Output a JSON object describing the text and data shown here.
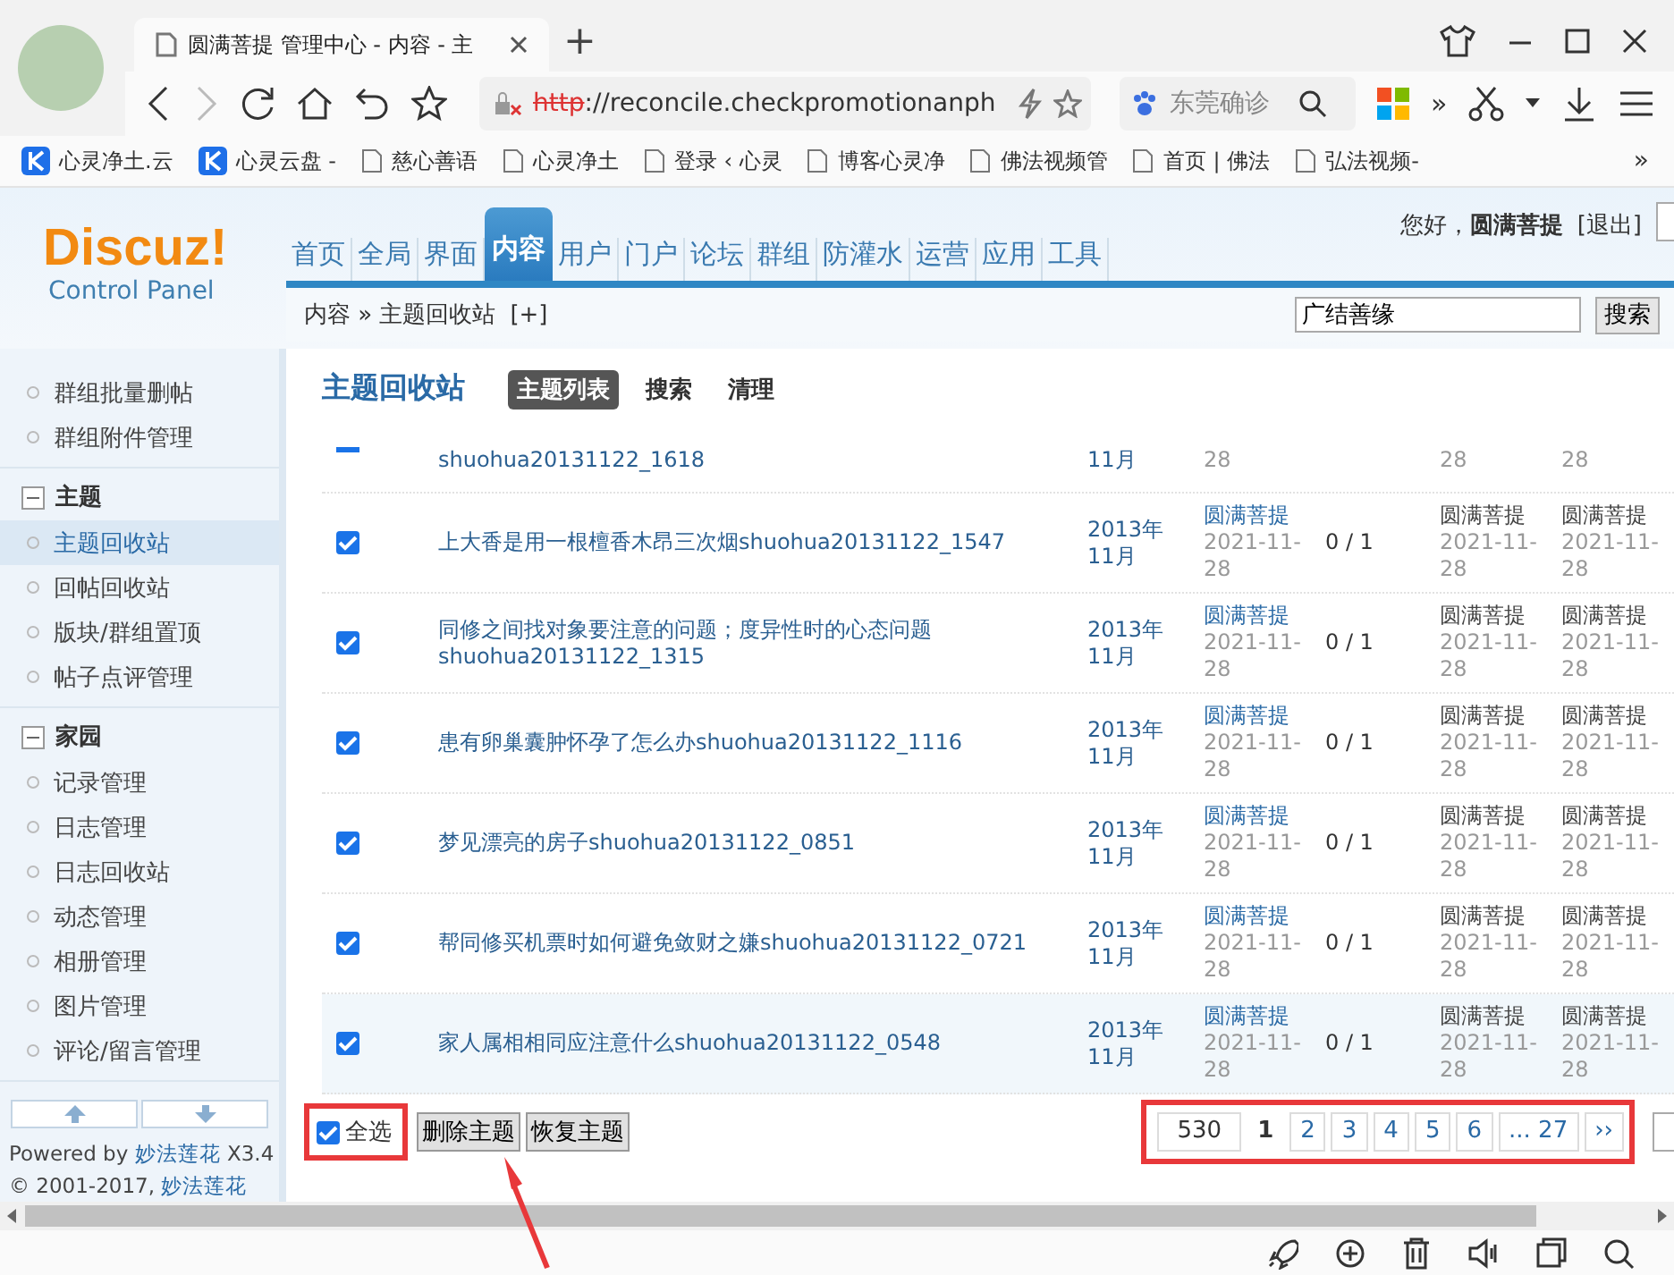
{
  "browser": {
    "tab_title": "圆满菩提 管理中心 - 内容 - 主",
    "new_tab": "+",
    "url_scheme": "http",
    "url_rest": "://reconcile.checkpromotionanph",
    "search_placeholder": "东莞确诊",
    "overflow": "»",
    "bookmarks_more": "»",
    "bookmarks": [
      {
        "label": "心灵净土.云",
        "kind": "app"
      },
      {
        "label": "心灵云盘 -",
        "kind": "app"
      },
      {
        "label": "慈心善语",
        "kind": "page"
      },
      {
        "label": "心灵净土",
        "kind": "page"
      },
      {
        "label": "登录 ‹ 心灵",
        "kind": "page"
      },
      {
        "label": "博客心灵净",
        "kind": "page"
      },
      {
        "label": "佛法视频管",
        "kind": "page"
      },
      {
        "label": "首页 | 佛法",
        "kind": "page"
      },
      {
        "label": "弘法视频-",
        "kind": "page"
      }
    ]
  },
  "header": {
    "logo": "Discuz!",
    "logo_sub": "Control Panel",
    "greeting": "您好，",
    "user": "圆满菩提",
    "logout": "[退出]",
    "nav": [
      {
        "label": "首页",
        "selected": false
      },
      {
        "label": "全局",
        "selected": false
      },
      {
        "label": "界面",
        "selected": false
      },
      {
        "label": "内容",
        "selected": true
      },
      {
        "label": "用户",
        "selected": false
      },
      {
        "label": "门户",
        "selected": false
      },
      {
        "label": "论坛",
        "selected": false
      },
      {
        "label": "群组",
        "selected": false
      },
      {
        "label": "防灌水",
        "selected": false
      },
      {
        "label": "运营",
        "selected": false
      },
      {
        "label": "应用",
        "selected": false
      },
      {
        "label": "工具",
        "selected": false
      }
    ]
  },
  "breadcrumb": {
    "path": "内容 » 主题回收站",
    "add": "[+]",
    "search_value": "广结善缘",
    "search_button": "搜索"
  },
  "sidebar": {
    "groups": [
      {
        "items": [
          {
            "label": "群组批量删帖",
            "selected": false
          },
          {
            "label": "群组附件管理",
            "selected": false
          }
        ]
      },
      {
        "title": "主题",
        "expanded": true,
        "items": [
          {
            "label": "主题回收站",
            "selected": true
          },
          {
            "label": "回帖回收站",
            "selected": false
          },
          {
            "label": "版块/群组置顶",
            "selected": false
          },
          {
            "label": "帖子点评管理",
            "selected": false
          }
        ]
      },
      {
        "title": "家园",
        "expanded": true,
        "items": [
          {
            "label": "记录管理",
            "selected": false
          },
          {
            "label": "日志管理",
            "selected": false
          },
          {
            "label": "日志回收站",
            "selected": false
          },
          {
            "label": "动态管理",
            "selected": false
          },
          {
            "label": "相册管理",
            "selected": false
          },
          {
            "label": "图片管理",
            "selected": false
          },
          {
            "label": "评论/留言管理",
            "selected": false
          }
        ]
      }
    ],
    "powered_prefix": "Powered by ",
    "powered_link": "妙法莲花",
    "powered_suffix": " X3.4",
    "copyright_prefix": "© 2001-2017, ",
    "copyright_link": "妙法莲花"
  },
  "content": {
    "title": "主题回收站",
    "tabs": [
      {
        "label": "主题列表",
        "selected": true
      },
      {
        "label": "搜索",
        "selected": false
      },
      {
        "label": "清理",
        "selected": false
      }
    ],
    "rows": [
      {
        "kind": "partial",
        "checked": true,
        "highlighted": false,
        "title": "shuohua20131122_1618",
        "date": "11月",
        "author_date": "28",
        "last_date": "28",
        "delete_date": "28"
      },
      {
        "kind": "full",
        "checked": true,
        "highlighted": false,
        "title": "上大香是用一根檀香木昂三次烟shuohua20131122_1547",
        "date": "2013年11月",
        "author": "圆满菩提",
        "author_date": "2021-11-28",
        "replies": "0 / 1",
        "last_poster": "圆满菩提",
        "last_date": "2021-11-28",
        "deleter": "圆满菩提",
        "delete_date": "2021-11-28"
      },
      {
        "kind": "full",
        "checked": true,
        "highlighted": false,
        "title": "同修之间找对象要注意的问题；度异性时的心态问题shuohua20131122_1315",
        "date": "2013年11月",
        "author": "圆满菩提",
        "author_date": "2021-11-28",
        "replies": "0 / 1",
        "last_poster": "圆满菩提",
        "last_date": "2021-11-28",
        "deleter": "圆满菩提",
        "delete_date": "2021-11-28"
      },
      {
        "kind": "full",
        "checked": true,
        "highlighted": false,
        "title": "患有卵巢囊肿怀孕了怎么办shuohua20131122_1116",
        "date": "2013年11月",
        "author": "圆满菩提",
        "author_date": "2021-11-28",
        "replies": "0 / 1",
        "last_poster": "圆满菩提",
        "last_date": "2021-11-28",
        "deleter": "圆满菩提",
        "delete_date": "2021-11-28"
      },
      {
        "kind": "full",
        "checked": true,
        "highlighted": false,
        "title": "梦见漂亮的房子shuohua20131122_0851",
        "date": "2013年11月",
        "author": "圆满菩提",
        "author_date": "2021-11-28",
        "replies": "0 / 1",
        "last_poster": "圆满菩提",
        "last_date": "2021-11-28",
        "deleter": "圆满菩提",
        "delete_date": "2021-11-28"
      },
      {
        "kind": "full",
        "checked": true,
        "highlighted": false,
        "title": "帮同修买机票时如何避免敛财之嫌shuohua20131122_0721",
        "date": "2013年11月",
        "author": "圆满菩提",
        "author_date": "2021-11-28",
        "replies": "0 / 1",
        "last_poster": "圆满菩提",
        "last_date": "2021-11-28",
        "deleter": "圆满菩提",
        "delete_date": "2021-11-28"
      },
      {
        "kind": "full",
        "checked": true,
        "highlighted": true,
        "title": "家人属相相同应注意什么shuohua20131122_0548",
        "date": "2013年11月",
        "author": "圆满菩提",
        "author_date": "2021-11-28",
        "replies": "0 / 1",
        "last_poster": "圆满菩提",
        "last_date": "2021-11-28",
        "deleter": "圆满菩提",
        "delete_date": "2021-11-28"
      }
    ],
    "select_all": {
      "label": "全选",
      "checked": true
    },
    "buttons": [
      "删除主题",
      "恢复主题"
    ],
    "pagination": [
      {
        "label": "530",
        "kind": "total"
      },
      {
        "label": "1",
        "kind": "current"
      },
      {
        "label": "2",
        "kind": "page"
      },
      {
        "label": "3",
        "kind": "page"
      },
      {
        "label": "4",
        "kind": "page"
      },
      {
        "label": "5",
        "kind": "page"
      },
      {
        "label": "6",
        "kind": "page"
      },
      {
        "label": "... 27",
        "kind": "page"
      },
      {
        "label": "››",
        "kind": "next"
      }
    ]
  },
  "annotations": {
    "select_all_framed": true,
    "pagination_framed": true,
    "arrow": true
  }
}
